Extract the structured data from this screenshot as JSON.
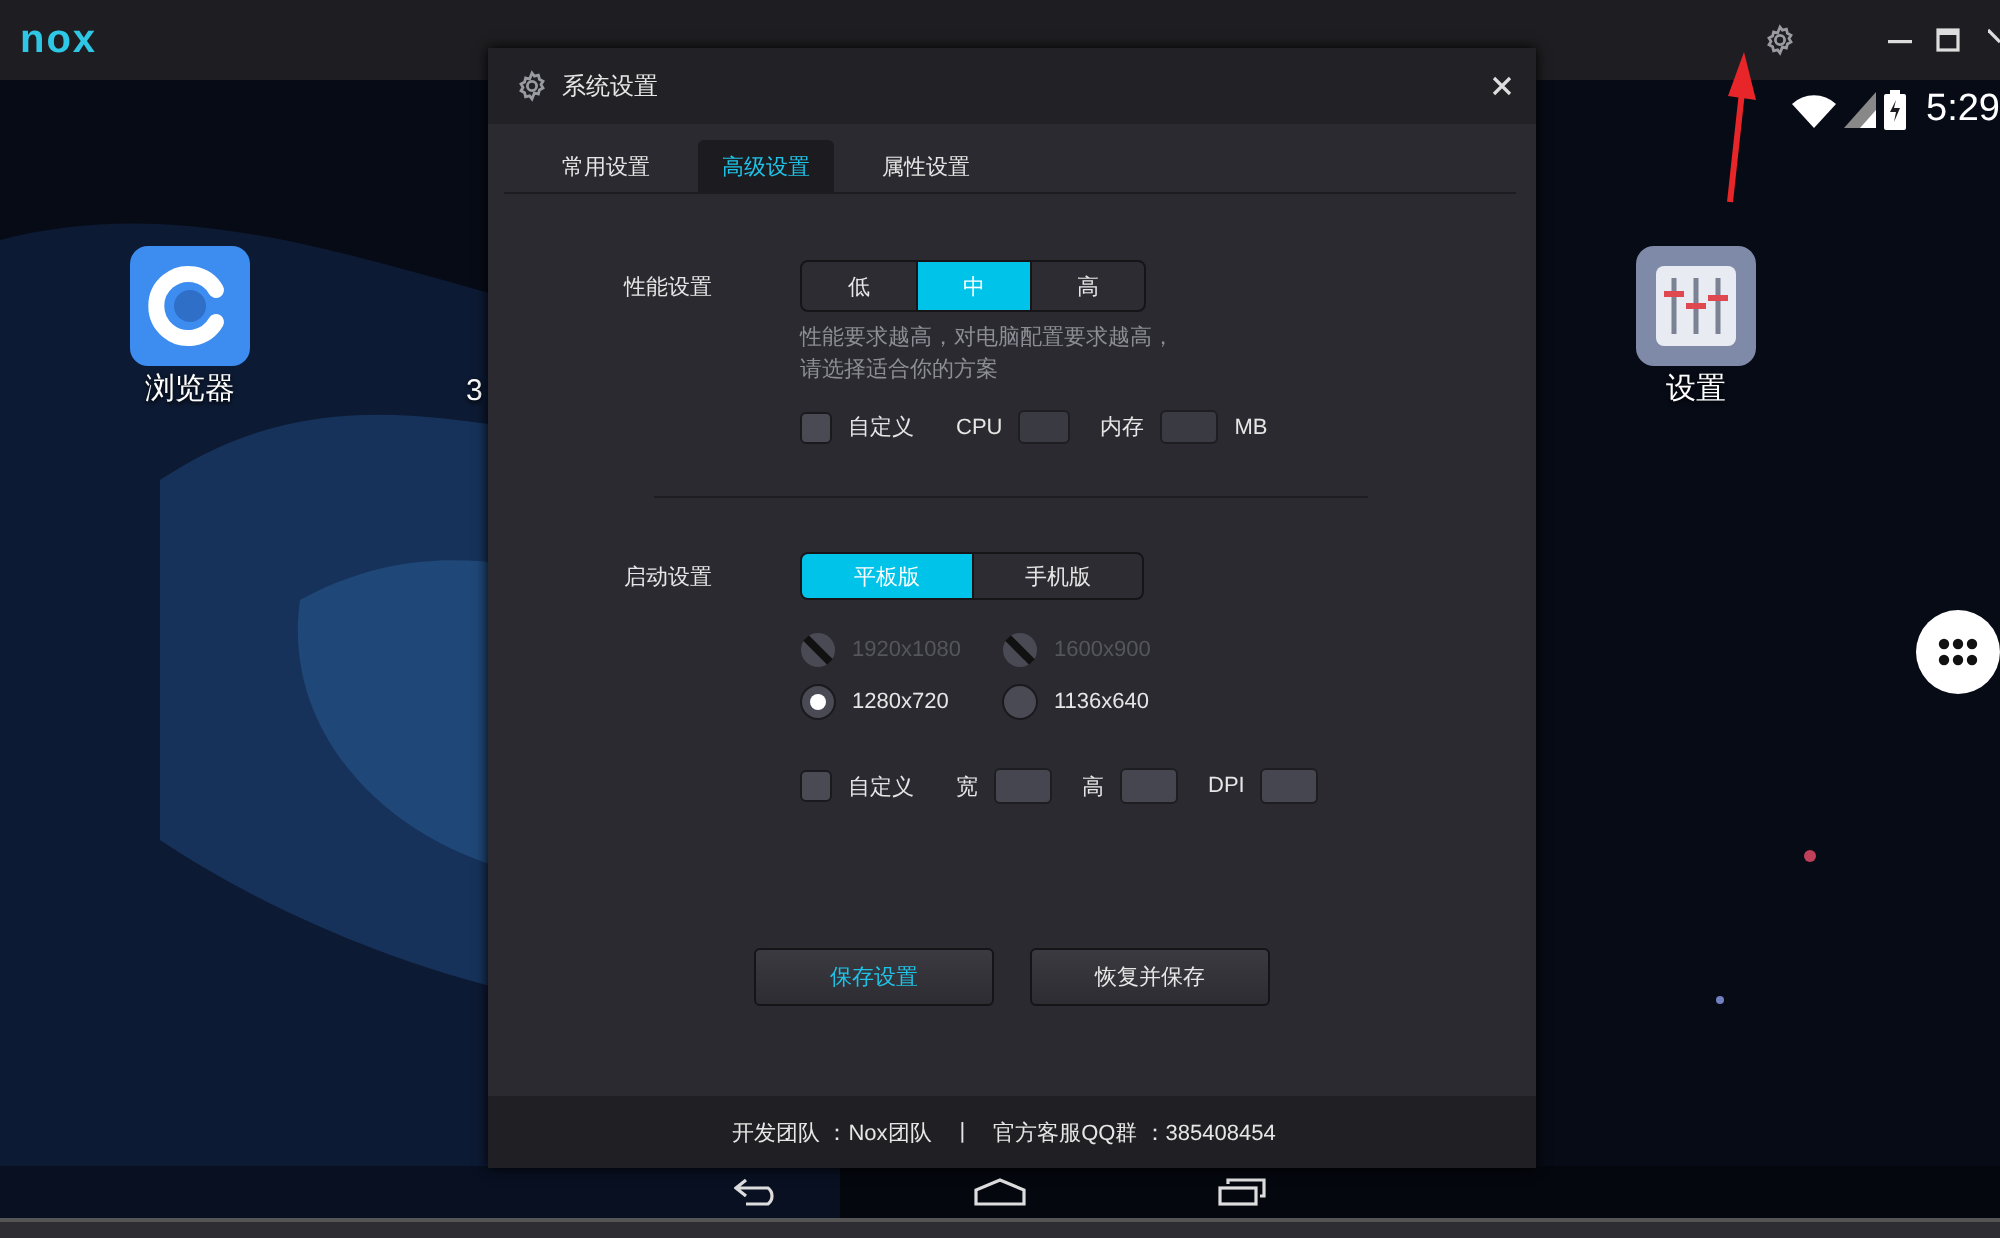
{
  "emulator": {
    "logo": "nox",
    "time": "5:29",
    "apps": [
      {
        "label": "浏览器",
        "kind": "browser"
      },
      {
        "label": "3",
        "kind": "hidden"
      },
      {
        "label": "设置",
        "kind": "settings"
      }
    ]
  },
  "dialog": {
    "title": "系统设置",
    "tabs": [
      {
        "label": "常用设置",
        "selected": false
      },
      {
        "label": "高级设置",
        "selected": true
      },
      {
        "label": "属性设置",
        "selected": false
      }
    ],
    "performance": {
      "label": "性能设置",
      "options": [
        {
          "label": "低",
          "selected": false
        },
        {
          "label": "中",
          "selected": true
        },
        {
          "label": "高",
          "selected": false
        }
      ],
      "hint": [
        "性能要求越高，对电脑配置要求越高，",
        "请选择适合你的方案"
      ],
      "custom": {
        "label": "自定义",
        "checked": false
      },
      "cpu_label": "CPU",
      "memory_label": "内存",
      "memory_unit": "MB"
    },
    "startup": {
      "label": "启动设置",
      "modes": [
        {
          "label": "平板版",
          "selected": true
        },
        {
          "label": "手机版",
          "selected": false
        }
      ],
      "resolutions": [
        {
          "label": "1920x1080",
          "disabled": true,
          "selected": false
        },
        {
          "label": "1600x900",
          "disabled": true,
          "selected": false
        },
        {
          "label": "1280x720",
          "disabled": false,
          "selected": true
        },
        {
          "label": "1136x640",
          "disabled": false,
          "selected": false
        }
      ],
      "custom": {
        "label": "自定义",
        "checked": false
      },
      "width_label": "宽",
      "height_label": "高",
      "dpi_label": "DPI"
    },
    "buttons": [
      {
        "label": "保存设置",
        "primary": true
      },
      {
        "label": "恢复并保存",
        "primary": false
      }
    ],
    "footer": {
      "team": "开发团队 ：Nox团队",
      "separator": "|",
      "qq": "官方客服QQ群 ：385408454"
    }
  }
}
